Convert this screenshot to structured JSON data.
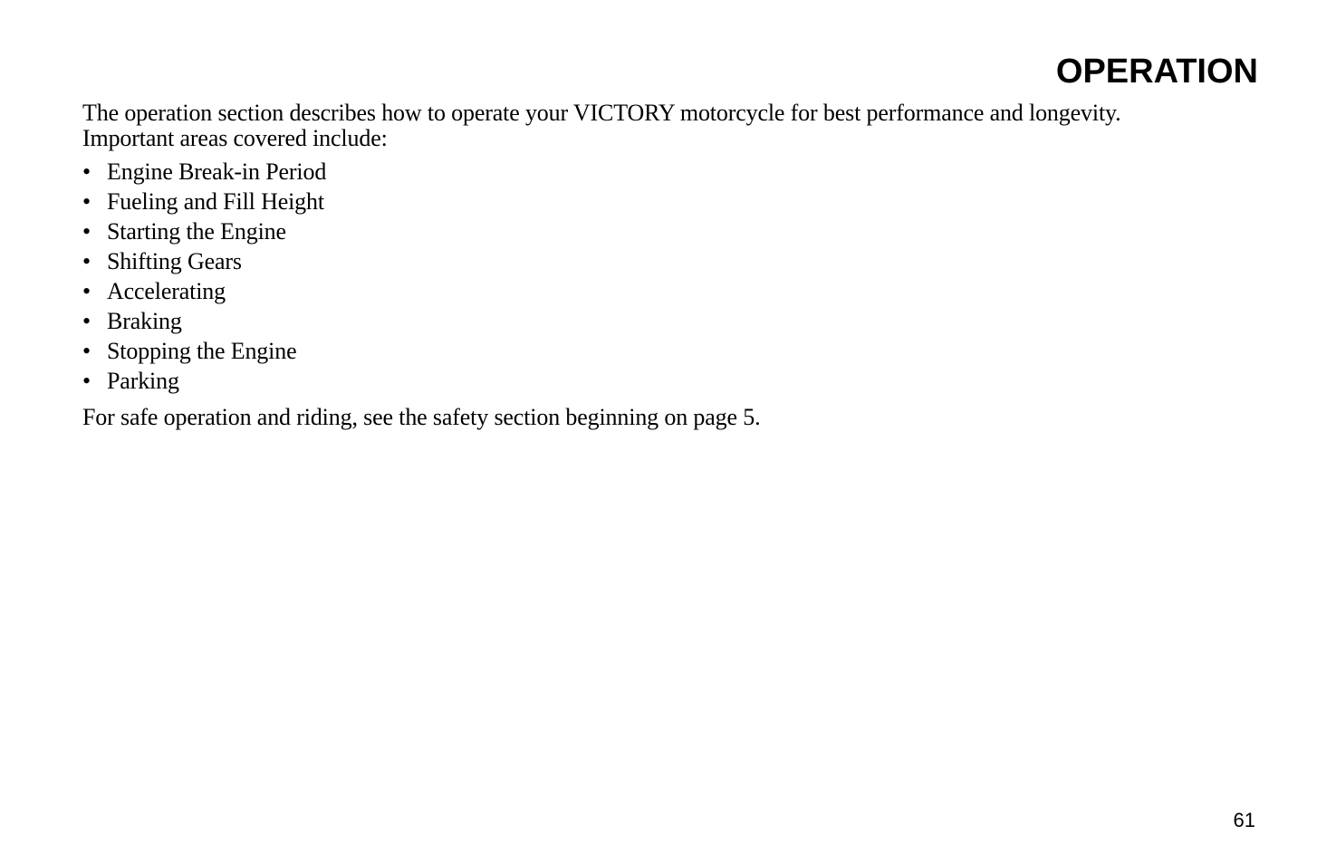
{
  "header": {
    "title": "OPERATION"
  },
  "intro": {
    "line1": "The operation section describes how to operate your VICTORY motorcycle for best performance and longevity.",
    "line2": "Important areas covered include:"
  },
  "topics": {
    "bullet_glyph": "•",
    "items": [
      "Engine Break-in Period",
      "Fueling and Fill Height",
      "Starting the Engine",
      "Shifting Gears",
      "Accelerating",
      "Braking",
      "Stopping the Engine",
      "Parking"
    ]
  },
  "closing": {
    "text": "For safe operation and riding, see the safety section beginning on page 5."
  },
  "footer": {
    "page_number": "61"
  }
}
